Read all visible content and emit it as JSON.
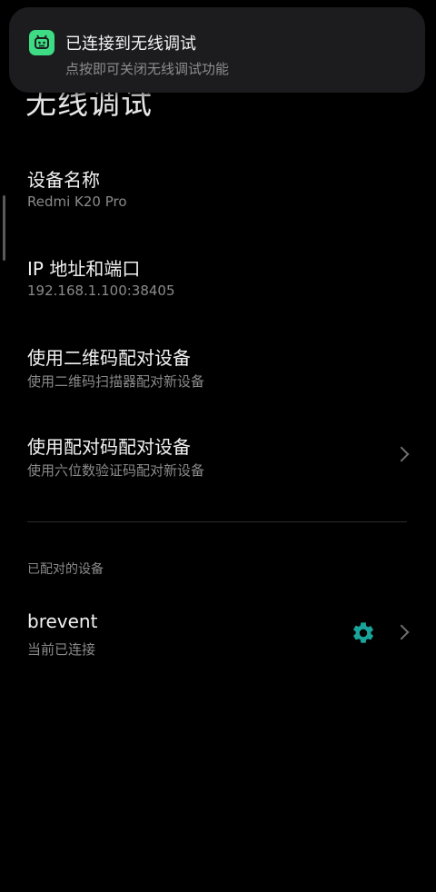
{
  "notification": {
    "title": "已连接到无线调试",
    "text": "点按即可关闭无线调试功能",
    "icon": "android-debug-icon",
    "icon_color": "#3ddc84"
  },
  "page": {
    "title": "无线调试"
  },
  "items": [
    {
      "title": "设备名称",
      "summary": "Redmi K20 Pro"
    },
    {
      "title": "IP 地址和端口",
      "summary": "192.168.1.100:38405"
    },
    {
      "title": "使用二维码配对设备",
      "summary": "使用二维码扫描器配对新设备"
    },
    {
      "title": "使用配对码配对设备",
      "summary": "使用六位数验证码配对新设备",
      "chevron": "chevron-right-icon"
    }
  ],
  "paired_section": {
    "header": "已配对的设备",
    "devices": [
      {
        "name": "brevent",
        "status": "当前已连接",
        "settings_icon": "gear-icon",
        "chevron": "chevron-right-icon",
        "accent": "#1aa39a"
      }
    ]
  }
}
